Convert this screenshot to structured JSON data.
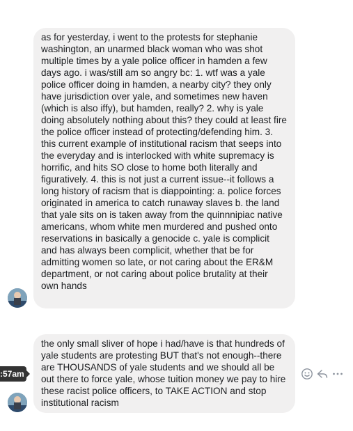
{
  "messages": [
    {
      "text": "as for yesterday, i went to the protests for stephanie washington, an unarmed black woman who was shot multiple times by a yale police officer in hamden a few days ago. i was/still am so angry bc: 1. wtf was a yale police officer doing in hamden, a nearby city? they only have jurisdiction over yale, and sometimes new haven (which is also iffy), but hamden, really? 2. why is yale doing absolutely nothing about this? they could at least fire the police officer instead of protecting/defending him. 3. this current example of institutional racism that seeps into the everyday and is interlocked with white supremacy is horrific, and hits SO close to home both literally and figuratively. 4. this is not just a current issue--it follows a long history of racism that is diappointing: a. police forces originated in america to catch runaway slaves b. the land that yale sits on is taken away from the quinnnipiac native americans, whom white men murdered and pushed onto reservations in basically a genocide c. yale is complicit and has always been complicit, whether that be for admitting women so late, or not caring about the ER&M department, or not caring about police brutality at their own hands"
    },
    {
      "text": "the only small sliver of hope i had/have is that hundreds of yale students are protesting BUT that's not enough--there are THOUSANDS of yale students and we should all be out there to force yale, whose tuition money we pay to hire these racist police officers, to TAKE ACTION and stop institutional racism"
    }
  ],
  "timestamp_tooltip": ":57am",
  "message_actions": [
    "emoji-react-icon",
    "reply-icon",
    "more-icon"
  ],
  "colors": {
    "bubble": "#f1f0f0",
    "text": "#1c1e21",
    "tooltip": "#333333",
    "icon": "#8d949e"
  }
}
